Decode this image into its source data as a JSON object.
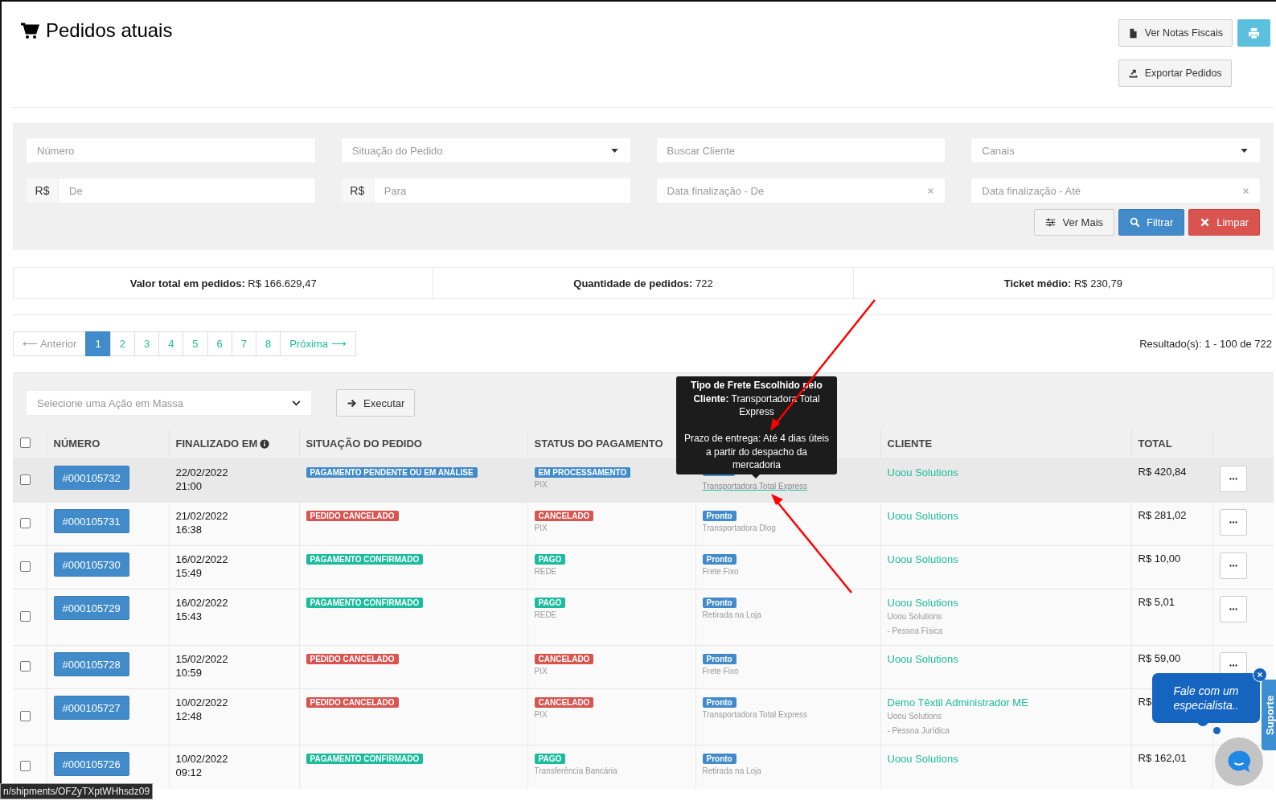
{
  "page": {
    "title": "Pedidos atuais"
  },
  "header_buttons": [
    {
      "kind": "invoices",
      "label": "Ver Notas Fiscais"
    },
    {
      "kind": "print"
    },
    {
      "kind": "export",
      "label": "Exportar Pedidos"
    }
  ],
  "filters": {
    "fields": [
      {
        "kind": "text",
        "placeholder": "Número"
      },
      {
        "kind": "select",
        "placeholder": "Situação do Pedido"
      },
      {
        "kind": "text",
        "placeholder": "Buscar Cliente"
      },
      {
        "kind": "select",
        "placeholder": "Canais"
      },
      {
        "kind": "money",
        "prefix": "R$",
        "placeholder": "De"
      },
      {
        "kind": "money",
        "prefix": "R$",
        "placeholder": "Para"
      },
      {
        "kind": "date",
        "placeholder": "Data finalização - De"
      },
      {
        "kind": "date",
        "placeholder": "Data finalização - Até"
      }
    ],
    "buttons": [
      {
        "kind": "more",
        "label": "Ver Mais"
      },
      {
        "kind": "filter",
        "label": "Filtrar"
      },
      {
        "kind": "clear",
        "label": "Limpar"
      }
    ]
  },
  "stats": [
    {
      "label": "Valor total em pedidos:",
      "value": "R$ 166.629,47"
    },
    {
      "label": "Quantidade de pedidos:",
      "value": "722"
    },
    {
      "label": "Ticket médio:",
      "value": "R$ 230,79"
    }
  ],
  "pagination": {
    "previous": {
      "label": "⟵ Anterior",
      "disabled": true
    },
    "pages": [
      {
        "label": "1",
        "selected": true
      },
      {
        "label": "2",
        "selected": false
      },
      {
        "label": "3",
        "selected": false
      },
      {
        "label": "4",
        "selected": false
      },
      {
        "label": "5",
        "selected": false
      },
      {
        "label": "6",
        "selected": false
      },
      {
        "label": "7",
        "selected": false
      },
      {
        "label": "8",
        "selected": false
      }
    ],
    "next": {
      "label": "Próxima ⟶",
      "disabled": false
    },
    "results": "Resultado(s): 1 - 100 de 722"
  },
  "mass_action": {
    "placeholder": "Selecione uma Ação em Massa",
    "button": "Executar"
  },
  "table": {
    "select_all_checked": false,
    "header": {
      "number": "NÚMERO",
      "finalized": "FINALIZADO EM",
      "finalized_info": true,
      "order_status": "SITUAÇÃO DO PEDIDO",
      "payment_status": "STATUS DO PAGAMENTO",
      "customer": "CLIENTE",
      "total": "TOTAL"
    },
    "rows": [
      {
        "checked": false,
        "hovered": true,
        "number": "#000105732",
        "date": "22/02/2022",
        "time": "21:00",
        "order_status": {
          "label": "PAGAMENTO PENDENTE OU EM ANÁLISE",
          "color": "#428bca"
        },
        "payment": {
          "label": "EM PROCESSAMENTO",
          "color": "#428bca",
          "method": "PIX"
        },
        "shipping": {
          "method": "Transportadora Total Express",
          "link": true
        },
        "customer": {
          "name": "Uoou Solutions"
        },
        "total": "R$ 420,84",
        "actions": true
      },
      {
        "checked": false,
        "hovered": false,
        "number": "#000105731",
        "date": "21/02/2022",
        "time": "16:38",
        "order_status": {
          "label": "PEDIDO CANCELADO",
          "color": "#d9534f"
        },
        "payment": {
          "label": "CANCELADO",
          "color": "#d9534f",
          "method": "PIX"
        },
        "shipping": {
          "label": "Pronto",
          "method": "Transportadora Dlog",
          "link": false
        },
        "customer": {
          "name": "Uoou Solutions"
        },
        "total": "R$ 281,02",
        "actions": true
      },
      {
        "checked": false,
        "hovered": false,
        "number": "#000105730",
        "date": "16/02/2022",
        "time": "15:49",
        "order_status": {
          "label": "PAGAMENTO CONFIRMADO",
          "color": "#1abc9c"
        },
        "payment": {
          "label": "PAGO",
          "color": "#1abc9c",
          "method": "REDE"
        },
        "shipping": {
          "label": "Pronto",
          "method": "Frete Fixo",
          "link": false
        },
        "customer": {
          "name": "Uoou Solutions"
        },
        "total": "R$ 10,00",
        "actions": true
      },
      {
        "checked": false,
        "hovered": false,
        "number": "#000105729",
        "date": "16/02/2022",
        "time": "15:43",
        "order_status": {
          "label": "PAGAMENTO CONFIRMADO",
          "color": "#1abc9c"
        },
        "payment": {
          "label": "PAGO",
          "color": "#1abc9c",
          "method": "REDE"
        },
        "shipping": {
          "label": "Pronto",
          "method": "Retirada na Loja",
          "link": false
        },
        "customer": {
          "name": "Uoou Solutions",
          "details": [
            "Uoou Solutions",
            "- Pessoa Física"
          ]
        },
        "total": "R$ 5,01",
        "actions": true
      },
      {
        "checked": false,
        "hovered": false,
        "number": "#000105728",
        "date": "15/02/2022",
        "time": "10:59",
        "order_status": {
          "label": "PEDIDO CANCELADO",
          "color": "#d9534f"
        },
        "payment": {
          "label": "CANCELADO",
          "color": "#d9534f",
          "method": "PIX"
        },
        "shipping": {
          "label": "Pronto",
          "method": "Frete Fixo",
          "link": false
        },
        "customer": {
          "name": "Uoou Solutions"
        },
        "total": "R$ 59,00",
        "actions": true
      },
      {
        "checked": false,
        "hovered": false,
        "number": "#000105727",
        "date": "10/02/2022",
        "time": "12:48",
        "order_status": {
          "label": "PEDIDO CANCELADO",
          "color": "#d9534f"
        },
        "payment": {
          "label": "CANCELADO",
          "color": "#d9534f",
          "method": "PIX"
        },
        "shipping": {
          "label": "Pronto",
          "method": "Transportadora Total Express",
          "link": false
        },
        "customer": {
          "name": "Demo Têxtil Administrador ME",
          "details": [
            "Uoou Solutions",
            "- Pessoa Jurídica"
          ]
        },
        "total": "R$",
        "actions": false
      },
      {
        "checked": false,
        "hovered": false,
        "number": "#000105726",
        "date": "10/02/2022",
        "time": "09:12",
        "order_status": {
          "label": "PAGAMENTO CONFIRMADO",
          "color": "#1abc9c"
        },
        "payment": {
          "label": "PAGO",
          "color": "#1abc9c",
          "method": "Transferência Bancária"
        },
        "shipping": {
          "label": "Pronto",
          "method": "Retirada na Loja",
          "link": false
        },
        "customer": {
          "name": "Uoou Solutions"
        },
        "total": "R$ 162,01",
        "actions": false
      }
    ]
  },
  "tooltip": {
    "heading": "**Tipo de Frete Escolhido pelo Cliente:** Transportadora Total Express",
    "body": "Prazo de entrega: Até 4 dias úteis a partir do despacho da mercadoria"
  },
  "chat": {
    "message": "Fale com um especialista..",
    "tab": "Suporte"
  },
  "status_url": "n/shipments/OFZyTXptWHhsdz09"
}
